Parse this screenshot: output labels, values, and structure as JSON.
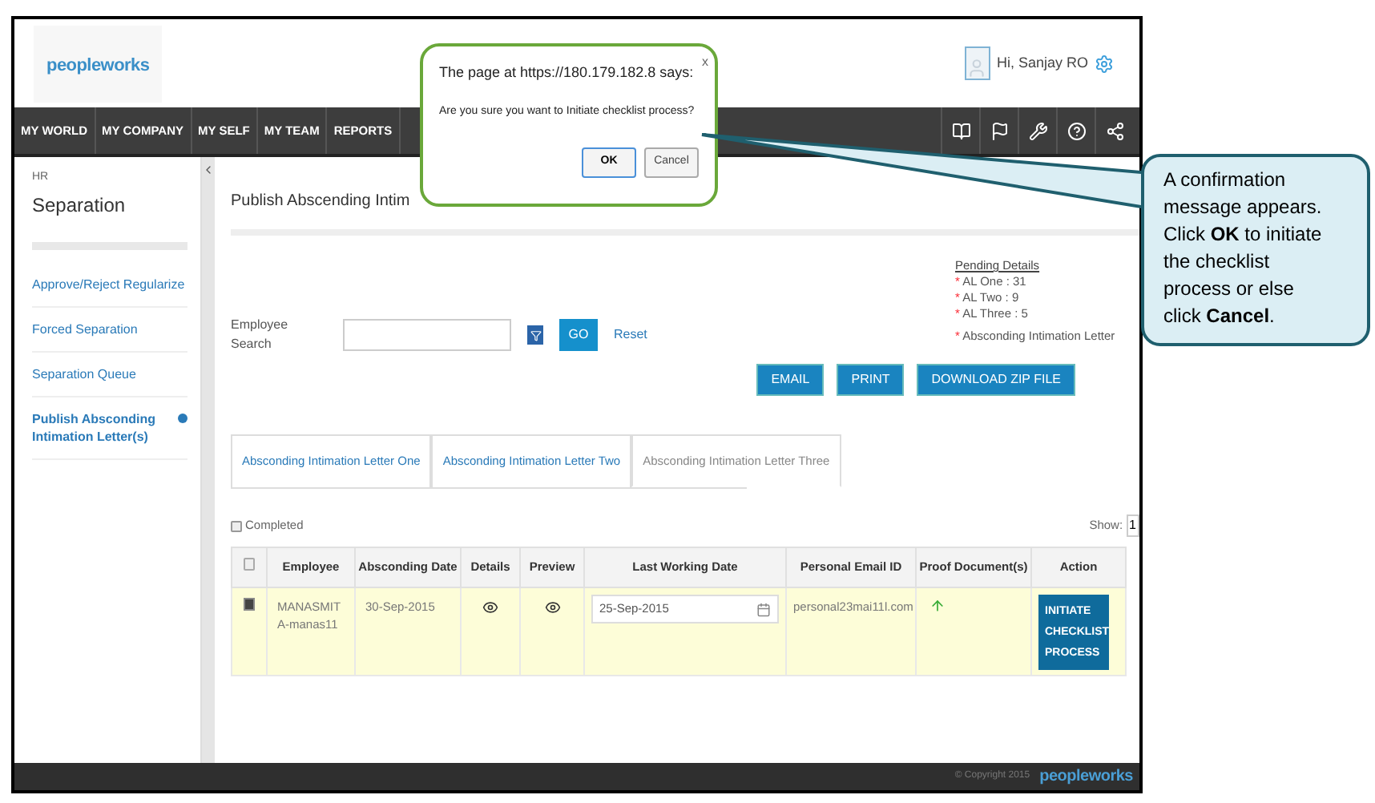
{
  "header": {
    "logo": "peopleworks",
    "greeting": "Hi, Sanjay RO"
  },
  "nav": {
    "items": [
      {
        "label": "MY WORLD"
      },
      {
        "label": "MY COMPANY"
      },
      {
        "label": "MY SELF"
      },
      {
        "label": "MY TEAM"
      },
      {
        "label": "REPORTS"
      }
    ]
  },
  "sidebar": {
    "section": "HR",
    "title": "Separation",
    "items": [
      {
        "label": "Approve/Reject Regularize",
        "selected": false
      },
      {
        "label": "Forced Separation",
        "selected": false
      },
      {
        "label": "Separation Queue",
        "selected": false
      },
      {
        "label": "Publish Absconding Intimation Letter(s)",
        "selected": true
      }
    ]
  },
  "page": {
    "title": "Publish Abscending Intim",
    "pending": {
      "heading": "Pending Details",
      "marker": "*",
      "items": [
        "AL One : 31",
        "AL Two : 9",
        "AL Three : 5"
      ],
      "note": "Absconding Intimation Letter"
    },
    "search": {
      "label": "Employee Search",
      "go": "GO",
      "reset": "Reset"
    },
    "buttons": [
      "EMAIL",
      "PRINT",
      "DOWNLOAD ZIP FILE"
    ],
    "tabs": [
      {
        "label": "Absconding Intimation Letter One",
        "selected": false
      },
      {
        "label": "Absconding Intimation Letter Two",
        "selected": false
      },
      {
        "label": "Absconding Intimation Letter Three",
        "selected": true
      }
    ],
    "completed": {
      "label": "Completed",
      "checked": false
    },
    "show": {
      "label": "Show:",
      "value": "1"
    },
    "table": {
      "select_all_checked": false,
      "columns": [
        "Employee",
        "Absconding Date",
        "Details",
        "Preview",
        "Last Working Date",
        "Personal Email ID",
        "Proof Document(s)",
        "Action"
      ],
      "rows": [
        {
          "checked": true,
          "employee": "MANASMITA-manas11",
          "absconding_date": "30-Sep-2015",
          "last_working_date": "25-Sep-2015",
          "email": "personal23mai11l.com",
          "action": "INITIATE CHECKLIST PROCESS"
        }
      ]
    }
  },
  "footer": {
    "copyright": "© Copyright 2015",
    "logo": "peopleworks"
  },
  "dialog": {
    "title": "The page at https://180.179.182.8 says:",
    "close": "x",
    "message": "Are you sure you want to Initiate checklist process?",
    "buttons": [
      "OK",
      "Cancel"
    ]
  },
  "callout": {
    "text": "A confirmation message appears. Click **OK** to initiate the checklist process or else click **Cancel**."
  }
}
